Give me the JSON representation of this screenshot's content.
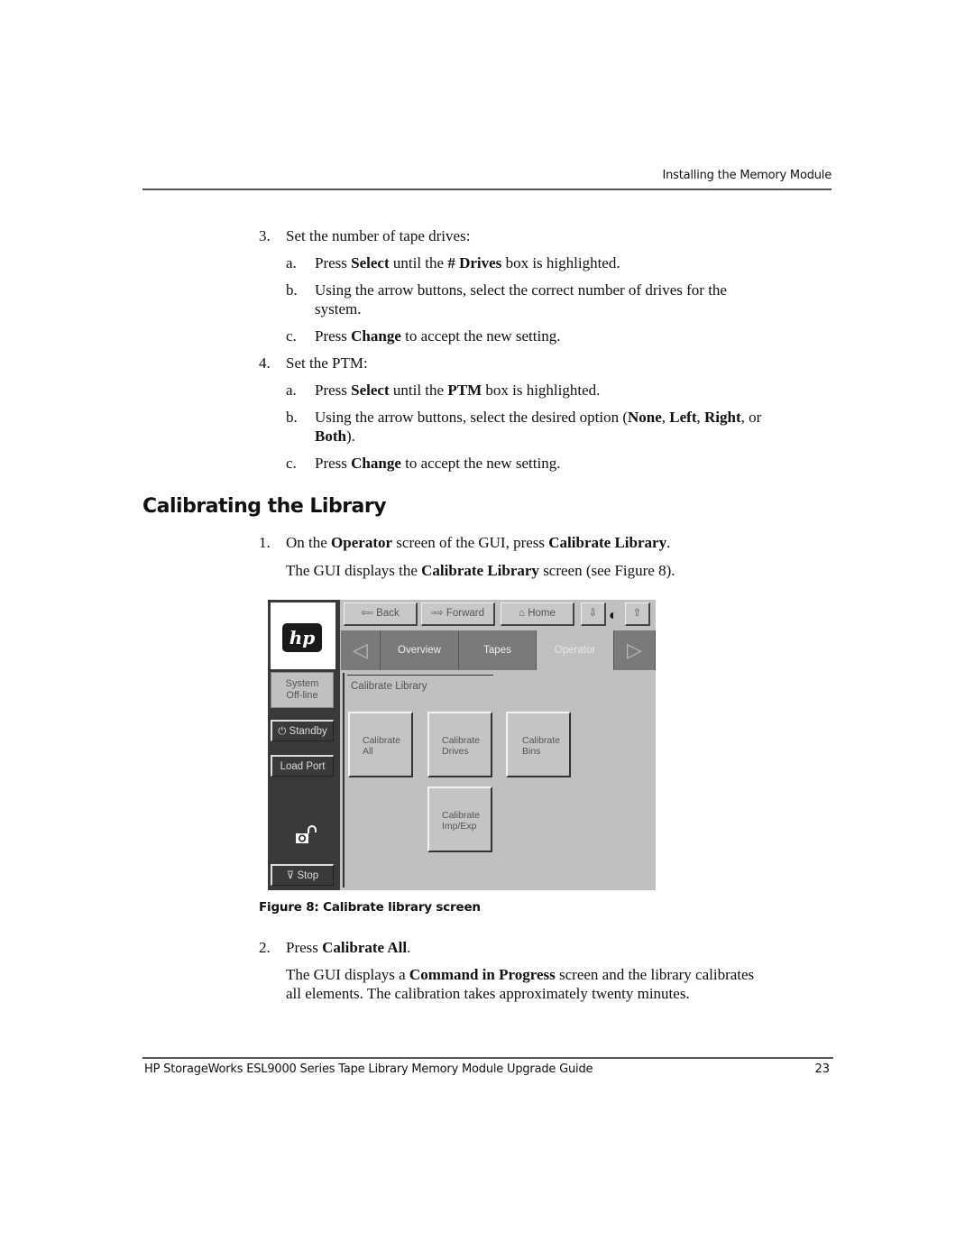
{
  "header": {
    "running_head": "Installing the Memory Module"
  },
  "steps_set": [
    {
      "num": "3.",
      "text": "Set the number of tape drives:",
      "substeps": [
        {
          "label": "a.",
          "parts": [
            "Press ",
            "Select",
            " until the ",
            "# Drives",
            " box is highlighted."
          ]
        },
        {
          "label": "b.",
          "line1": "Using the arrow buttons, select the correct number of drives for the",
          "line2": "system."
        },
        {
          "label": "c.",
          "parts": [
            "Press ",
            "Change",
            " to accept the new setting."
          ]
        }
      ]
    },
    {
      "num": "4.",
      "text": "Set the PTM:",
      "substeps": [
        {
          "label": "a.",
          "parts": [
            "Press ",
            "Select",
            " until the ",
            "PTM",
            " box is highlighted."
          ]
        },
        {
          "label": "b.",
          "parts": [
            "Using the arrow buttons, select the desired option (",
            "None",
            ", ",
            "Left",
            ", ",
            "Right",
            ", or"
          ],
          "line2_bold": "Both",
          "line2_rest": ")."
        },
        {
          "label": "c.",
          "parts": [
            "Press ",
            "Change",
            " to accept the new setting."
          ]
        }
      ]
    }
  ],
  "section": {
    "heading": "Calibrating the Library",
    "step1": {
      "num": "1.",
      "parts": [
        "On the ",
        "Operator",
        " screen of the GUI, press ",
        "Calibrate Library",
        "."
      ]
    },
    "step1_note": {
      "parts": [
        "The GUI displays the ",
        "Calibrate Library",
        " screen (see Figure 8)."
      ]
    },
    "step2": {
      "num": "2.",
      "parts": [
        "Press ",
        "Calibrate All",
        "."
      ]
    },
    "step2_note": {
      "line1_parts": [
        "The GUI displays a ",
        "Command in Progress",
        " screen and the library calibrates"
      ],
      "line2": "all elements. The calibration takes approximately twenty minutes."
    }
  },
  "figure": {
    "caption": "Figure 8:  Calibrate library screen",
    "logo": "hp",
    "status": [
      "System",
      "Off-line"
    ],
    "side_buttons": {
      "standby": "Standby",
      "load_port": "Load Port",
      "stop": "Stop"
    },
    "nav_buttons": {
      "back": "Back",
      "forward": "Forward",
      "home": "Home"
    },
    "tabs": [
      "Overview",
      "Tapes",
      "Operator"
    ],
    "active_tab": "Operator",
    "panel_title": "Calibrate Library",
    "calibrate_buttons": [
      {
        "line1": "Calibrate",
        "line2": "All"
      },
      {
        "line1": "Calibrate",
        "line2": "Drives"
      },
      {
        "line1": "Calibrate",
        "line2": "Bins"
      },
      {
        "line1": "Calibrate",
        "line2": "Imp/Exp"
      }
    ]
  },
  "footer": {
    "title": "HP StorageWorks ESL9000 Series Tape Library Memory Module Upgrade Guide",
    "page": "23"
  }
}
